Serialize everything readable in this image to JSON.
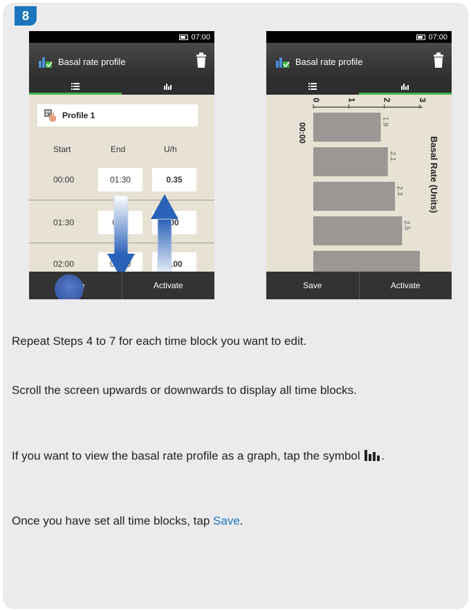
{
  "step_number": "8",
  "left_screen": {
    "status_time": "07:00",
    "title": "Basal rate profile",
    "profile_name": "Profile 1",
    "columns": [
      "Start",
      "End",
      "U/h"
    ],
    "rows": [
      {
        "start": "00:00",
        "end": "01:30",
        "rate": "0.35"
      },
      {
        "start": "01:30",
        "end": "0:_0",
        "rate": "00"
      },
      {
        "start": "02:00",
        "end": "03:00",
        "rate": "0.00"
      }
    ],
    "save_label": "Save",
    "activate_label": "Activate"
  },
  "right_screen": {
    "status_time": "07:00",
    "title": "Basal rate profile",
    "save_label": "Save",
    "activate_label": "Activate"
  },
  "chart_data": {
    "type": "bar",
    "orientation": "horizontal",
    "ylabel": "Basal Rate (Units)",
    "time_label": "00:00",
    "xlim": [
      0,
      3
    ],
    "x_ticks": [
      "0",
      "1",
      "2",
      "3"
    ],
    "values": [
      1.9,
      2.1,
      2.3,
      2.5,
      3.0
    ],
    "value_labels": [
      "1.9",
      "2.1",
      "2.3",
      "2.5",
      ""
    ]
  },
  "instructions": {
    "p1": "Repeat Steps 4 to 7 for each time block you want to edit.",
    "p2": "Scroll the screen upwards or downwards to display all time blocks.",
    "p3": "If you want to view the basal rate profile as a graph, tap the symbol",
    "p3_end": ".",
    "p4_prefix": "Once you have set all time blocks, tap ",
    "p4_link": "Save",
    "p4_suffix": "."
  },
  "colors": {
    "accent": "#1c75bc",
    "tab_active": "#43b549",
    "card": "#ebebed"
  }
}
